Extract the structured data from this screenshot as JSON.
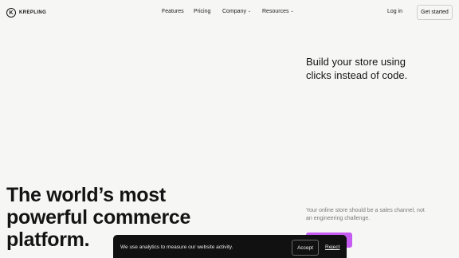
{
  "brand": {
    "name": "KREPLING",
    "icon": "k-circle-logo-icon"
  },
  "nav": {
    "features": "Features",
    "pricing": "Pricing",
    "company": "Company",
    "resources": "Resources",
    "dropdown_icon": "chevron-down-icon"
  },
  "actions": {
    "login": "Log in",
    "get_started": "Get started"
  },
  "hero": {
    "tagline": "Build your store using clicks instead of code.",
    "headline": "The world’s most powerful commerce platform.",
    "subtext": "Your online store should be a sales channel, not an engineering challenge."
  },
  "cookie_banner": {
    "message": "We use analytics to measure our website activity.",
    "accept": "Accept",
    "reject": "Reject"
  },
  "colors": {
    "background": "#f6f6f5",
    "accent": "#c55bf0",
    "banner": "#111111",
    "text": "#141414"
  }
}
